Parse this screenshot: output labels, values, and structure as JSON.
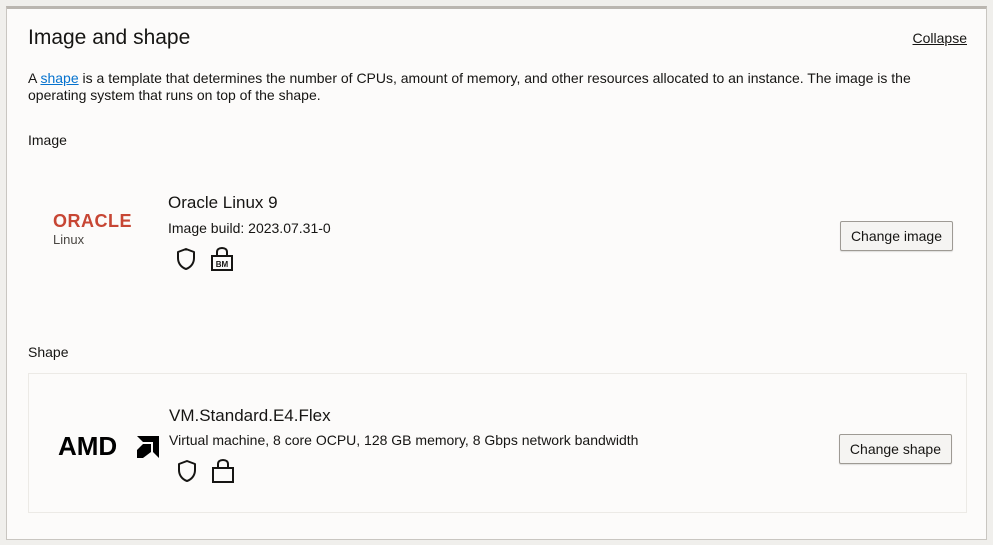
{
  "panel": {
    "title": "Image and shape",
    "collapse_label": "Collapse",
    "description_prefix": "A ",
    "description_link": "shape",
    "description_suffix": " is a template that determines the number of CPUs, amount of memory, and other resources allocated to an instance. The image is the operating system that runs on top of the shape."
  },
  "image": {
    "section_label": "Image",
    "logo_text": "ORACLE",
    "logo_subtext": "Linux",
    "name": "Oracle Linux 9",
    "build": "Image build: 2023.07.31-0",
    "icons": [
      "shield-icon",
      "bare-metal-lock-icon"
    ],
    "change_label": "Change image"
  },
  "shape": {
    "section_label": "Shape",
    "logo_text": "AMD",
    "name": "VM.Standard.E4.Flex",
    "details": "Virtual machine, 8 core OCPU, 128 GB memory, 8 Gbps network bandwidth",
    "icons": [
      "shield-icon",
      "lock-icon"
    ],
    "change_label": "Change shape"
  },
  "colors": {
    "oracle_red": "#c74634",
    "link_blue": "#0572ce",
    "text": "#161513"
  }
}
